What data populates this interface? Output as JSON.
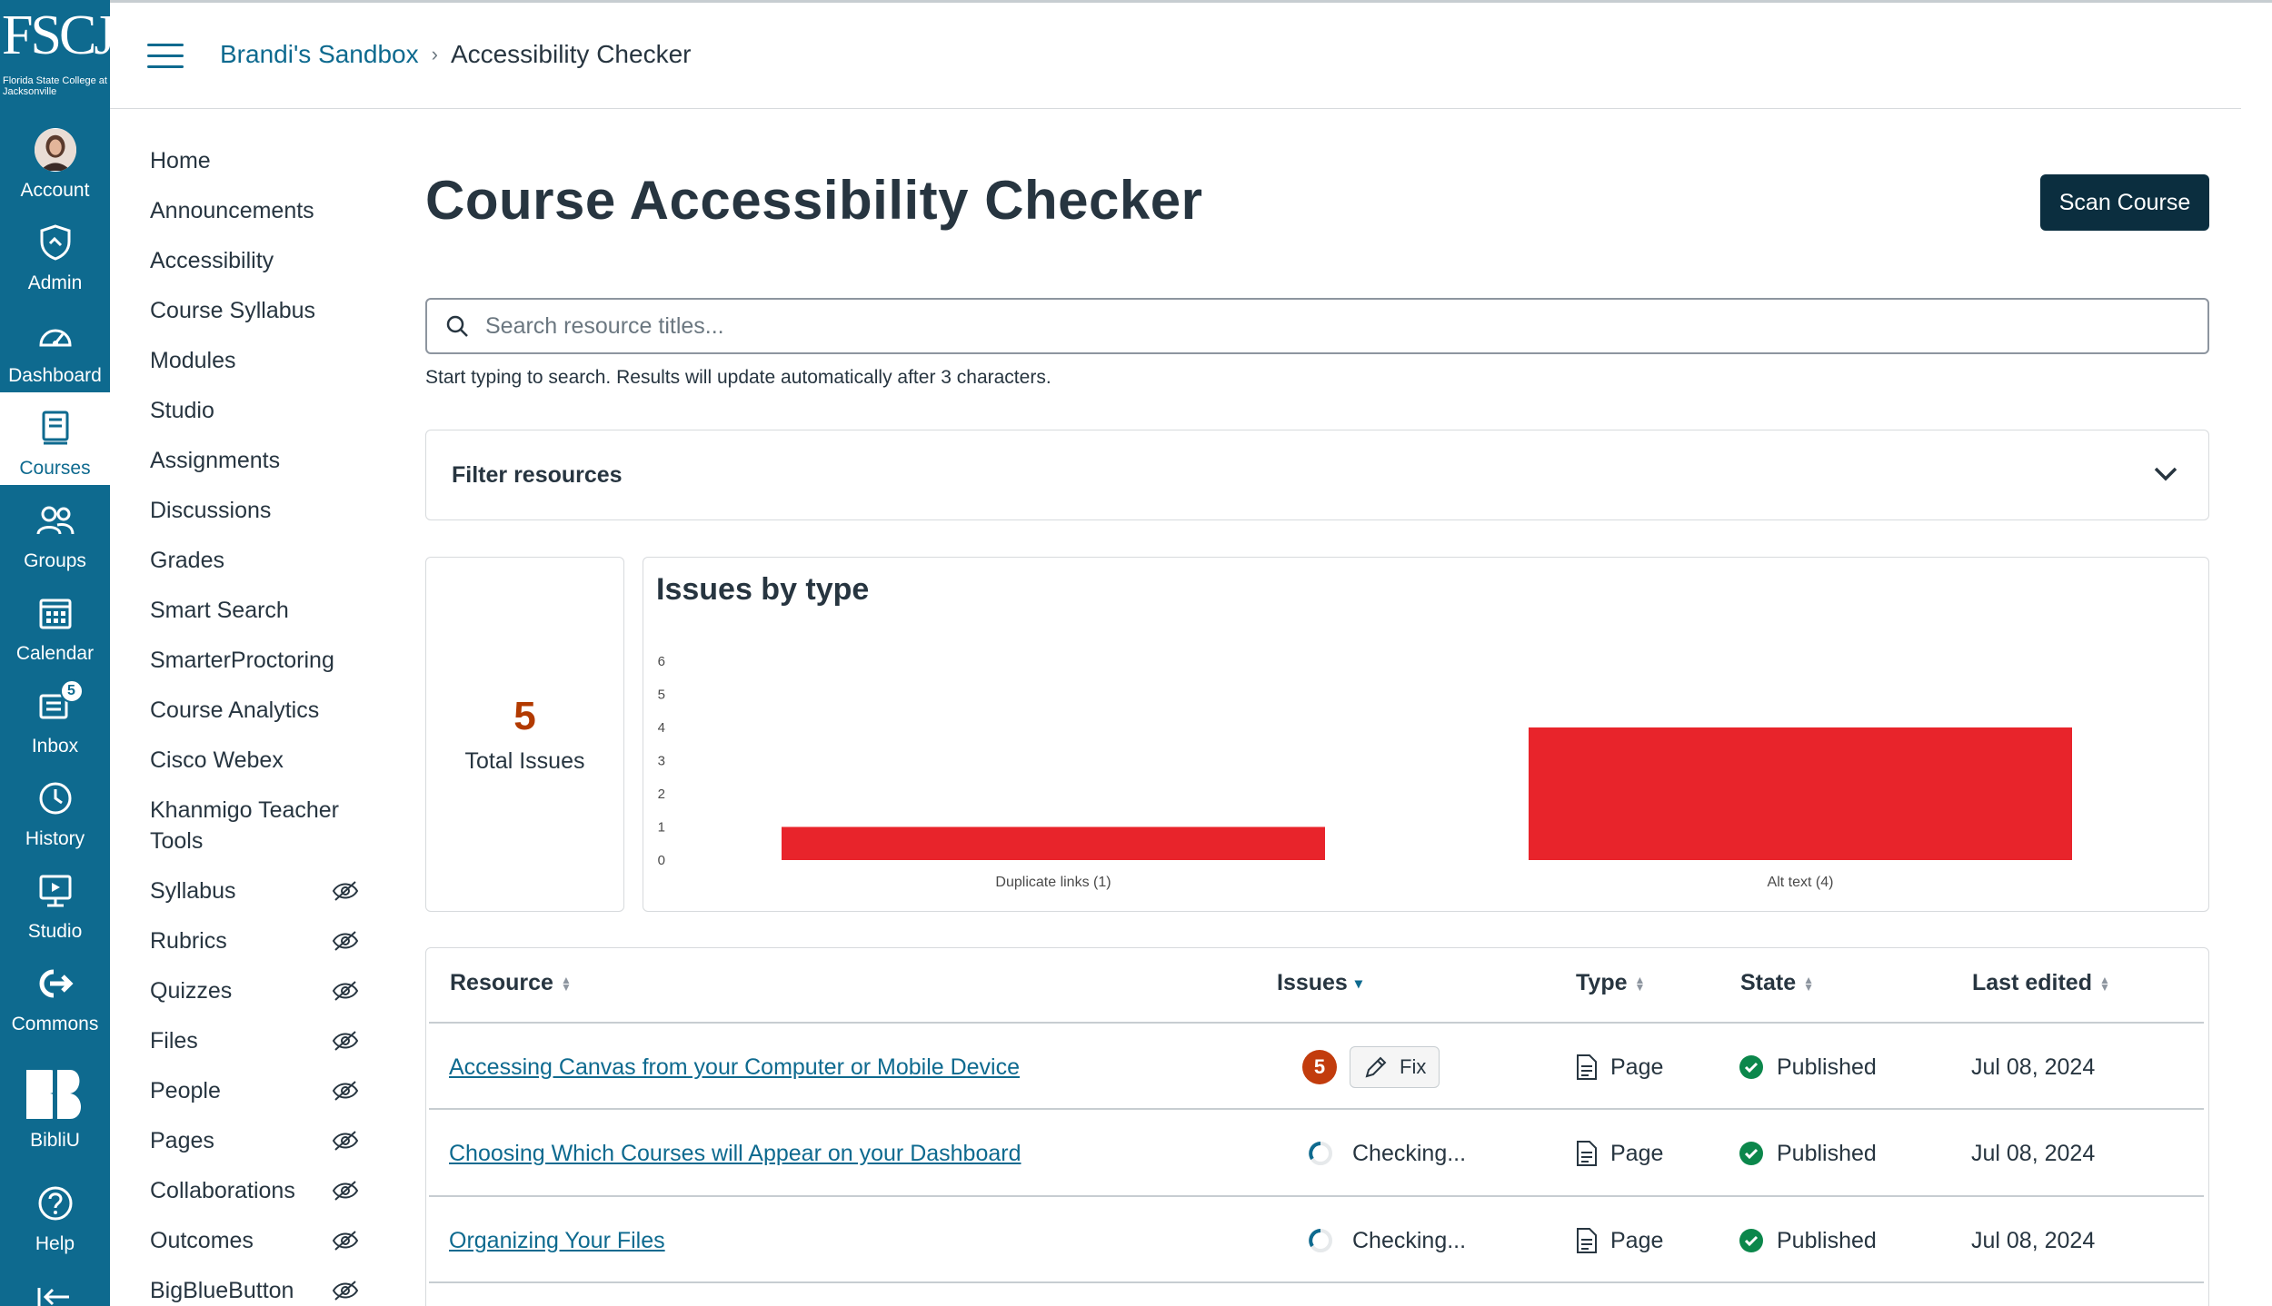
{
  "logo": {
    "mark": "FSCJ",
    "subtitle": "Florida State College at Jacksonville"
  },
  "global_nav": [
    {
      "label": "Account",
      "icon": "avatar"
    },
    {
      "label": "Admin",
      "icon": "shield-icon"
    },
    {
      "label": "Dashboard",
      "icon": "dashboard-icon"
    },
    {
      "label": "Courses",
      "icon": "book-icon",
      "active": true
    },
    {
      "label": "Groups",
      "icon": "groups-icon"
    },
    {
      "label": "Calendar",
      "icon": "calendar-icon"
    },
    {
      "label": "Inbox",
      "icon": "inbox-icon",
      "badge": "5"
    },
    {
      "label": "History",
      "icon": "clock-icon"
    },
    {
      "label": "Studio",
      "icon": "studio-icon"
    },
    {
      "label": "Commons",
      "icon": "commons-icon"
    },
    {
      "label": "BibliU",
      "icon": "bibliu-icon"
    },
    {
      "label": "Help",
      "icon": "help-icon"
    }
  ],
  "breadcrumb": {
    "course": "Brandi's Sandbox",
    "current": "Accessibility Checker"
  },
  "course_nav": [
    {
      "label": "Home"
    },
    {
      "label": "Announcements"
    },
    {
      "label": "Accessibility"
    },
    {
      "label": "Course Syllabus"
    },
    {
      "label": "Modules"
    },
    {
      "label": "Studio"
    },
    {
      "label": "Assignments"
    },
    {
      "label": "Discussions"
    },
    {
      "label": "Grades"
    },
    {
      "label": "Smart Search"
    },
    {
      "label": "SmarterProctoring"
    },
    {
      "label": "Course Analytics"
    },
    {
      "label": "Cisco Webex"
    },
    {
      "label": "Khanmigo Teacher Tools"
    },
    {
      "label": "Syllabus",
      "hidden": true
    },
    {
      "label": "Rubrics",
      "hidden": true
    },
    {
      "label": "Quizzes",
      "hidden": true
    },
    {
      "label": "Files",
      "hidden": true
    },
    {
      "label": "People",
      "hidden": true
    },
    {
      "label": "Pages",
      "hidden": true
    },
    {
      "label": "Collaborations",
      "hidden": true
    },
    {
      "label": "Outcomes",
      "hidden": true
    },
    {
      "label": "BigBlueButton",
      "hidden": true
    }
  ],
  "main": {
    "title": "Course Accessibility Checker",
    "scan_button": "Scan Course",
    "search": {
      "placeholder": "Search resource titles...",
      "hint": "Start typing to search. Results will update automatically after 3 characters."
    },
    "filter_label": "Filter resources",
    "total": {
      "value": "5",
      "label": "Total Issues"
    }
  },
  "chart_data": {
    "type": "bar",
    "title": "Issues by type",
    "categories": [
      "Duplicate links (1)",
      "Alt text (4)"
    ],
    "values": [
      1,
      4
    ],
    "ylim": [
      0,
      6
    ],
    "yticks": [
      "0",
      "1",
      "2",
      "3",
      "4",
      "5",
      "6"
    ],
    "color": "#e8242b",
    "grid": false
  },
  "table": {
    "headers": {
      "resource": "Resource",
      "issues": "Issues",
      "type": "Type",
      "state": "State",
      "last_edited": "Last edited"
    },
    "rows": [
      {
        "resource": "Accessing Canvas from your Computer or Mobile Device",
        "issues": "5",
        "fix": "Fix",
        "type": "Page",
        "state": "Published",
        "last_edited": "Jul 08, 2024"
      },
      {
        "resource": "Choosing Which Courses will Appear on your Dashboard",
        "issues_status": "Checking...",
        "type": "Page",
        "state": "Published",
        "last_edited": "Jul 08, 2024"
      },
      {
        "resource": "Organizing Your Files",
        "issues_status": "Checking...",
        "type": "Page",
        "state": "Published",
        "last_edited": "Jul 08, 2024"
      }
    ]
  },
  "colors": {
    "nav": "#0e6a8f",
    "scan_button": "#0b2e3f",
    "issue_badge": "#c23c0d",
    "published": "#0b874b",
    "bar": "#e8242b"
  }
}
